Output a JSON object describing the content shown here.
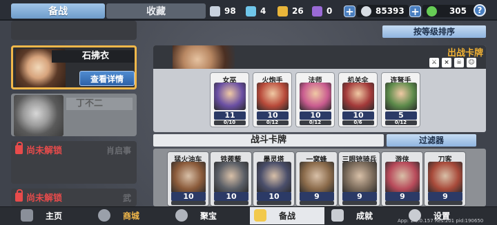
{
  "top_tabs": {
    "battle": "备战",
    "collection": "收藏"
  },
  "resources": [
    {
      "name": "silver-card-icon",
      "color": "#c9d2de",
      "value": "98"
    },
    {
      "name": "blue-card-icon",
      "color": "#6fc6ea",
      "value": "4"
    },
    {
      "name": "gold-card-icon",
      "color": "#e9b53a",
      "value": "26"
    },
    {
      "name": "purple-card-icon",
      "color": "#9a6ad6",
      "value": "0"
    },
    {
      "name": "coin-icon",
      "color": "#d8dde4",
      "value": "85393"
    },
    {
      "name": "gem-icon",
      "color": "#66cc55",
      "value": "305"
    }
  ],
  "help_label": "?",
  "plus_label": "+",
  "sort_button": "按等级排序",
  "heroes": {
    "selected": {
      "name": "石拂衣",
      "detail_button": "查看详情"
    },
    "second": {
      "name": "丁不二"
    },
    "locked_label": "尚未解锁",
    "locked_ghost_1": "肖启事",
    "locked_ghost_2": "武"
  },
  "deck": {
    "title": "出战卡牌",
    "icons": [
      "weapon-icon",
      "x3-icon",
      "skull-icon",
      "mask-icon"
    ],
    "cards": [
      {
        "name": "女巫",
        "level": "11",
        "progress": "0/10",
        "fill": 0.0,
        "color": "#6a4fa3"
      },
      {
        "name": "火炮手",
        "level": "10",
        "progress": "0/12",
        "fill": 0.0,
        "color": "#b84a3a"
      },
      {
        "name": "法师",
        "level": "10",
        "progress": "0/12",
        "fill": 0.0,
        "color": "#c95b8f"
      },
      {
        "name": "机关伞",
        "level": "10",
        "progress": "0/6",
        "fill": 0.0,
        "color": "#a33a3a"
      },
      {
        "name": "连弩手",
        "level": "5",
        "progress": "0/12",
        "fill": 0.0,
        "color": "#5c8a4a"
      }
    ]
  },
  "battle_cards": {
    "title": "战斗卡牌",
    "filter_button": "过滤器",
    "cards": [
      {
        "name": "猛火油车",
        "level": "10",
        "fill": 0.0,
        "color": "#8a5a3a"
      },
      {
        "name": "铁蒺藜",
        "level": "10",
        "fill": 0.0,
        "color": "#5a5e66"
      },
      {
        "name": "墨灵塔",
        "level": "10",
        "fill": 0.0,
        "color": "#4a4e6a"
      },
      {
        "name": "一窝蜂",
        "level": "9",
        "fill": 0.0,
        "color": "#8a6a4a"
      },
      {
        "name": "三眼铳骑兵",
        "level": "9",
        "fill": 0.0,
        "color": "#7a6a5a"
      },
      {
        "name": "游侠",
        "level": "9",
        "fill": 0.0,
        "color": "#b84a5a"
      },
      {
        "name": "刀客",
        "level": "9",
        "fill": 0.0,
        "color": "#a84a3a"
      }
    ]
  },
  "nav": {
    "home": "主页",
    "shop": "商城",
    "treasure": "聚宝",
    "battle": "备战",
    "achievements": "成就",
    "settings": "设置"
  },
  "app_version": "App: 1.0.0.157 Res:201 pid:190650"
}
